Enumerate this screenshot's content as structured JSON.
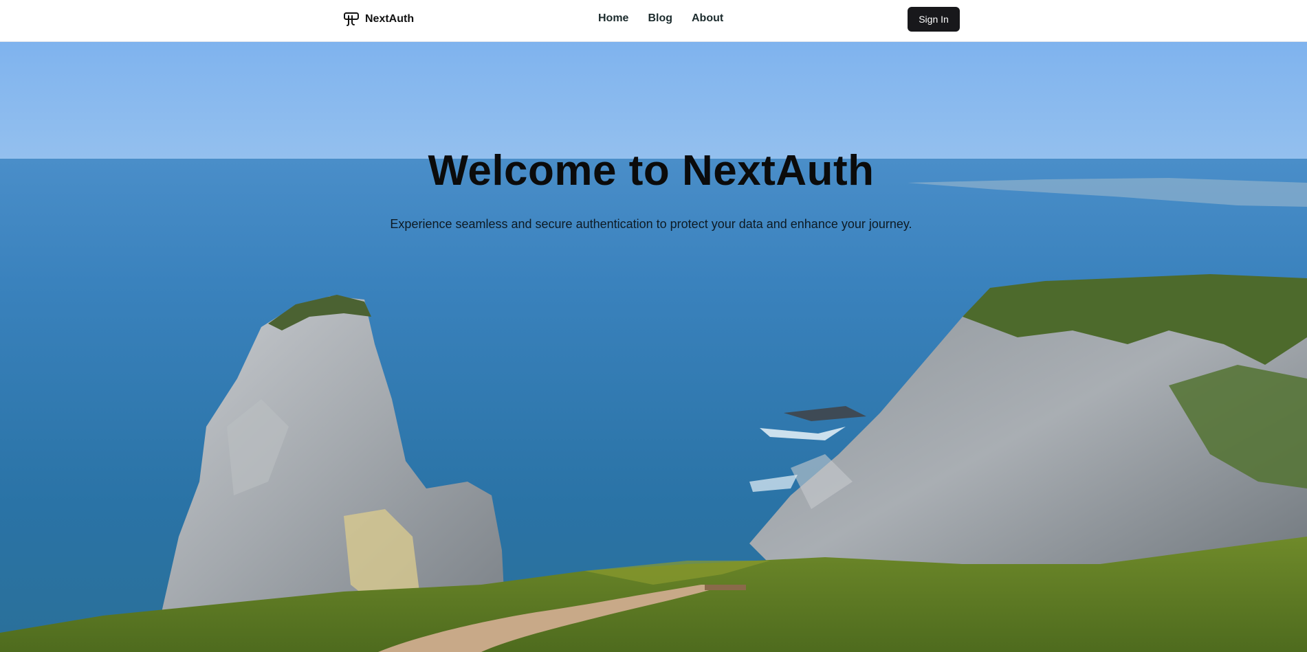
{
  "header": {
    "brand_name": "NextAuth",
    "brand_icon": "nextauth-logo-icon",
    "nav": [
      {
        "label": "Home"
      },
      {
        "label": "Blog"
      },
      {
        "label": "About"
      }
    ],
    "signin_label": "Sign In"
  },
  "hero": {
    "title": "Welcome to NextAuth",
    "subtitle": "Experience seamless and secure authentication to protect your data and enhance your journey.",
    "background": "coastal-cliffs-ocean-photo"
  },
  "colors": {
    "button_bg": "#18181b",
    "button_text": "#ffffff",
    "nav_text": "#1c2b2d",
    "sky": "#85b8ee",
    "ocean": "#2e78ad"
  }
}
